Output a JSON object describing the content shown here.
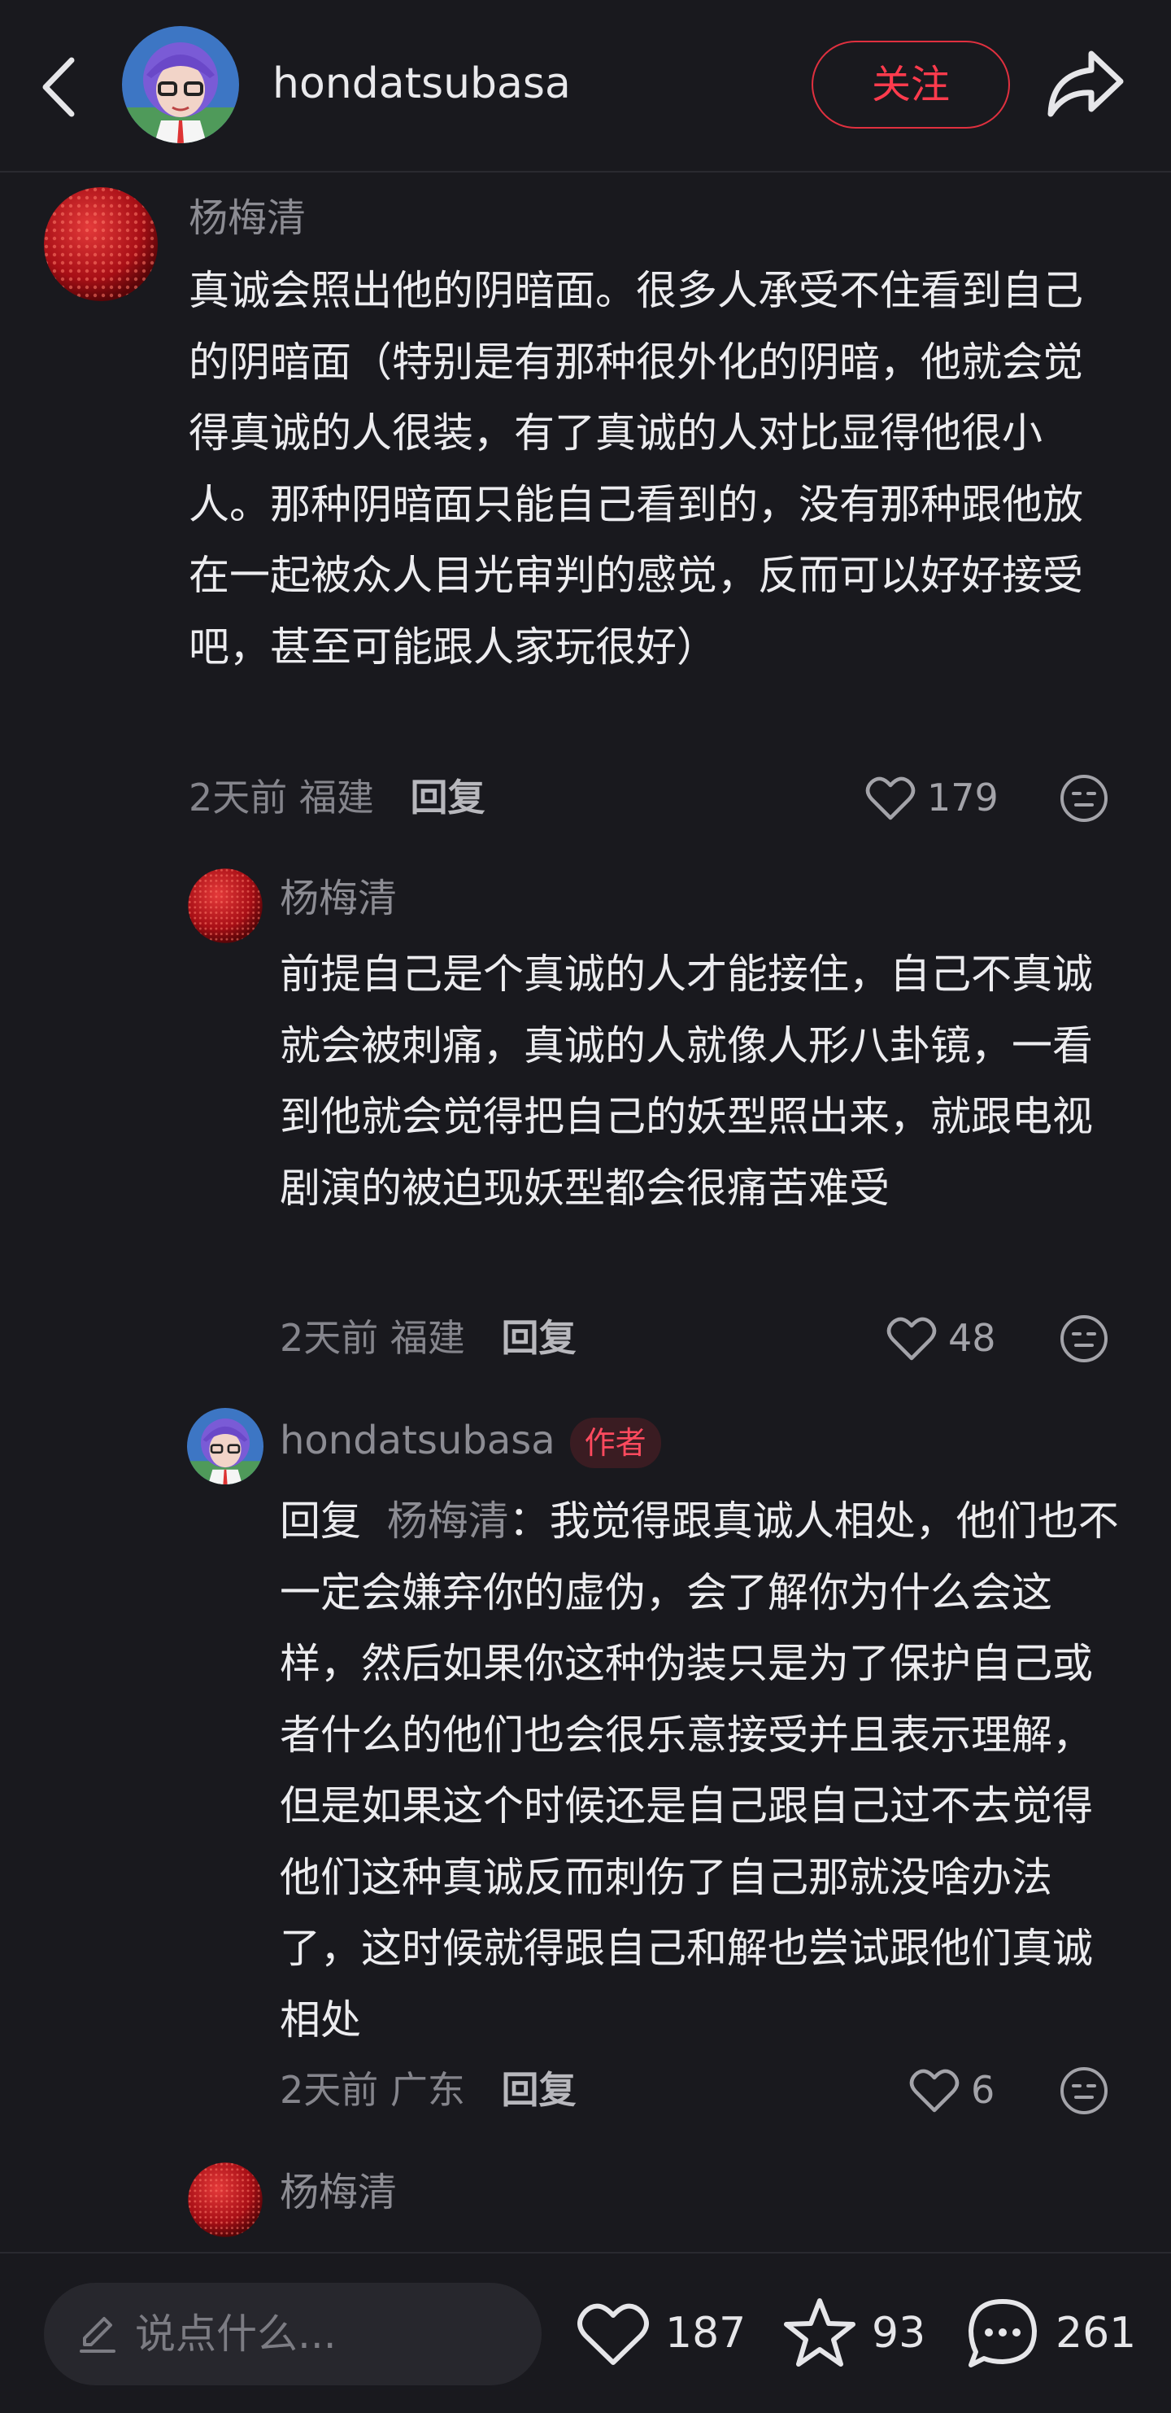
{
  "header": {
    "username": "hondatsubasa",
    "follow_label": "关注"
  },
  "comments": [
    {
      "author": "杨梅清",
      "text": "真诚会照出他的阴暗面。很多人承受不住看到自己的阴暗面（特别是有那种很外化的阴暗，他就会觉得真诚的人很装，有了真诚的人对比显得他很小人。那种阴暗面只能自己看到的，没有那种跟他放在一起被众人目光审判的感觉，反而可以好好接受吧，甚至可能跟人家玩很好）",
      "time": "2天前",
      "location": "福建",
      "reply_label": "回复",
      "likes": "179"
    },
    {
      "author": "杨梅清",
      "text": "前提自己是个真诚的人才能接住，自己不真诚就会被刺痛，真诚的人就像人形八卦镜，一看到他就会觉得把自己的妖型照出来，就跟电视剧演的被迫现妖型都会很痛苦难受",
      "time": "2天前",
      "location": "福建",
      "reply_label": "回复",
      "likes": "48"
    },
    {
      "author": "hondatsubasa",
      "badge": "作者",
      "reply_prefix": "回复",
      "mention": "杨梅清",
      "text": "：我觉得跟真诚人相处，他们也不一定会嫌弃你的虚伪，会了解你为什么会这样，然后如果你这种伪装只是为了保护自己或者什么的他们也会很乐意接受并且表示理解，但是如果这个时候还是自己跟自己过不去觉得他们这种真诚反而刺伤了自己那就没啥办法了，这时候就得跟自己和解也尝试跟他们真诚相处",
      "time": "2天前",
      "location": "广东",
      "reply_label": "回复",
      "likes": "6"
    },
    {
      "author": "杨梅清"
    }
  ],
  "bottom_bar": {
    "input_placeholder": "说点什么...",
    "likes": "187",
    "favorites": "93",
    "comments": "261"
  },
  "colors": {
    "background": "#19191e",
    "accent_red": "#ff3b4d",
    "secondary_text": "#8c8c93"
  }
}
